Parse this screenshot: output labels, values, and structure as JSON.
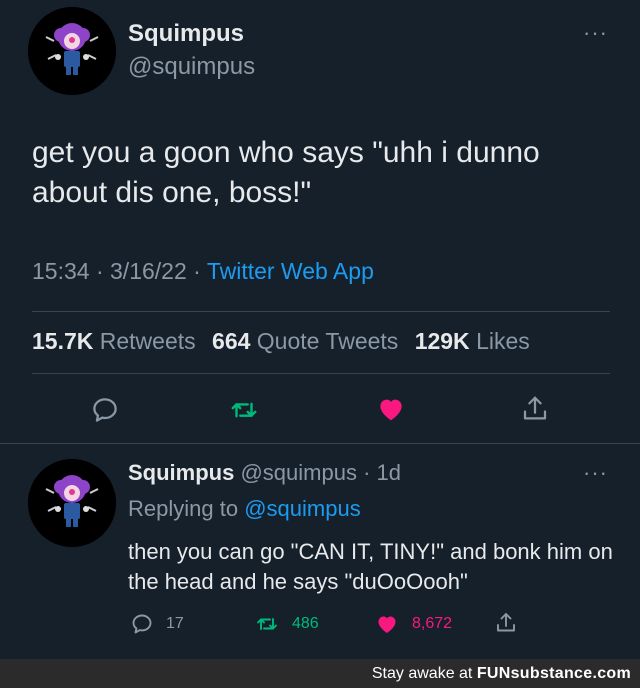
{
  "tweet": {
    "display_name": "Squimpus",
    "handle": "@squimpus",
    "text": "get you a goon who says \"uhh i dunno about dis one, boss!\"",
    "time": "15:34",
    "date": "3/16/22",
    "separator": "·",
    "source": "Twitter Web App",
    "stats": {
      "retweets_count": "15.7K",
      "retweets_label": "Retweets",
      "quotes_count": "664",
      "quotes_label": "Quote Tweets",
      "likes_count": "129K",
      "likes_label": "Likes"
    },
    "more_label": "···"
  },
  "reply": {
    "display_name": "Squimpus",
    "handle": "@squimpus",
    "age": "1d",
    "separator": "·",
    "replying_prefix": "Replying to",
    "replying_to": "@squimpus",
    "text": "then you can go \"CAN IT, TINY!\" and bonk him on the head and he says \"duOoOooh\"",
    "reply_count": "17",
    "retweet_count": "486",
    "like_count": "8,672",
    "more_label": "···"
  },
  "footer": {
    "prefix": "Stay awake at",
    "brand": "FUNsubstance.com"
  },
  "colors": {
    "background": "#15202b",
    "text": "#e7e9ea",
    "muted": "#8b98a5",
    "link": "#1d9bf0",
    "retweet_green": "#00ba7c",
    "like_pink": "#f91880",
    "divider": "#38444d"
  },
  "icons": {
    "reply": "reply-icon",
    "retweet": "retweet-icon",
    "like": "heart-icon",
    "share": "share-icon",
    "more": "more-icon"
  }
}
